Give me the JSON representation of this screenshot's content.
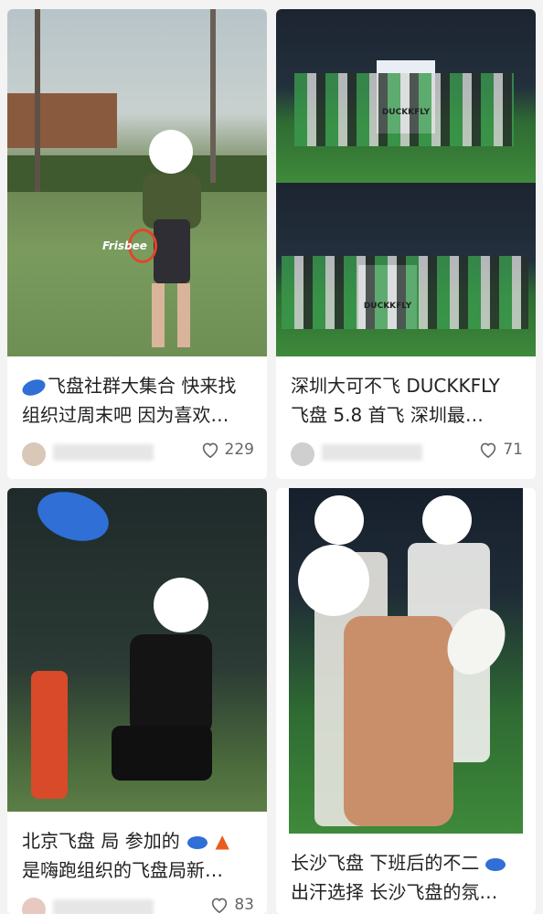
{
  "feed": [
    {
      "title_line1": "飞盘社群大集合 快来找",
      "title_line2": "组织过周末吧 因为喜欢…",
      "author": "Lynai Chen",
      "likes": "229",
      "photo_tag": "Frisbee"
    },
    {
      "title_line1": "深圳大可不飞 DUCKKFLY",
      "title_line2": "飞盘 5.8 首飞 深圳最…",
      "author": "大可不飞俱乐部",
      "likes": "71",
      "banner_text": "DUCKKFLY"
    },
    {
      "title_line1": "北京飞盘 局 参加的",
      "title_line2": "是嗨跑组织的飞盘局新…",
      "author": "嗨跑",
      "likes": "83"
    },
    {
      "title_line1": "长沙飞盘 下班后的不二",
      "title_line2": "出汗选择 长沙飞盘的氛…",
      "author": "",
      "likes": ""
    }
  ],
  "icons": {
    "frisbee": "frisbee-emoji-icon",
    "fire": "fire-emoji-icon",
    "heart": "heart-outline-icon"
  },
  "colors": {
    "frisbee_blue": "#2f6fd6",
    "text": "#222222",
    "meta": "#666666",
    "field_green": "#3e8a3a",
    "night_sky": "#1c2430"
  }
}
